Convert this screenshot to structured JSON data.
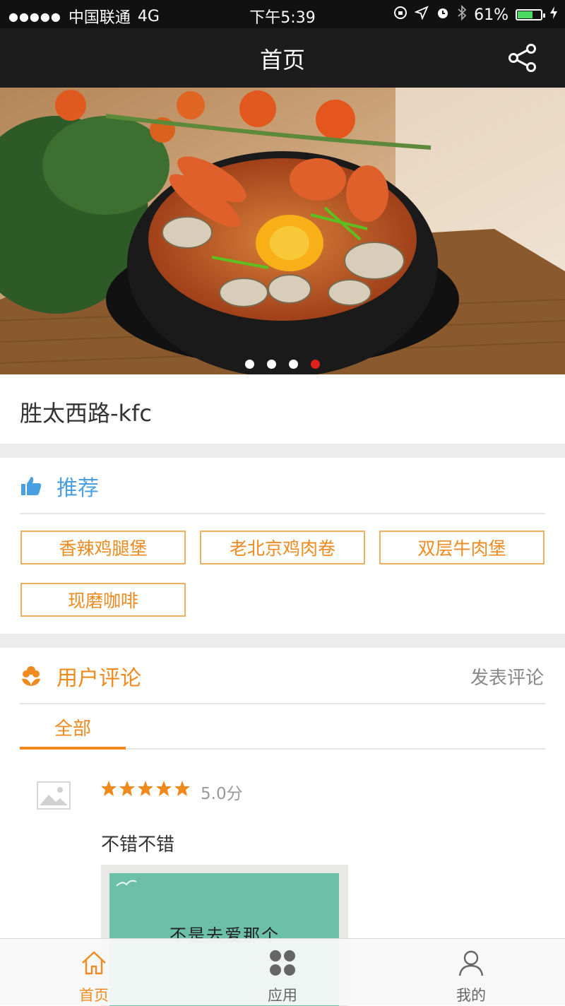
{
  "status_bar": {
    "carrier": "中国联通",
    "network": "4G",
    "time": "下午5:39",
    "battery": "61%",
    "battery_level": 0.61
  },
  "nav": {
    "title": "首页",
    "share_icon": "share-icon"
  },
  "banner": {
    "pages": 4,
    "active_page": 4
  },
  "store": {
    "name": "胜太西路-kfc"
  },
  "recommend": {
    "title": "推荐",
    "icon": "thumbs-up-icon",
    "items": [
      "香辣鸡腿堡",
      "老北京鸡肉卷",
      "双层牛肉堡",
      "现磨咖啡"
    ]
  },
  "reviews": {
    "title": "用户评论",
    "icon": "flower-icon",
    "post_label": "发表评论",
    "tabs": [
      "全部"
    ],
    "items": [
      {
        "rating": 5,
        "score": "5.0分",
        "text": "不错不错",
        "photo_caption": "不是去爱那个"
      }
    ]
  },
  "tab_bar": {
    "items": [
      {
        "label": "首页",
        "icon": "home-icon",
        "active": true
      },
      {
        "label": "应用",
        "icon": "apps-icon",
        "active": false
      },
      {
        "label": "我的",
        "icon": "user-icon",
        "active": false
      }
    ]
  },
  "colors": {
    "accent_orange": "#f08a1f",
    "accent_blue": "#4a9fe0",
    "nav_bg": "#1c1c1c",
    "pager_active": "#e0201a"
  }
}
